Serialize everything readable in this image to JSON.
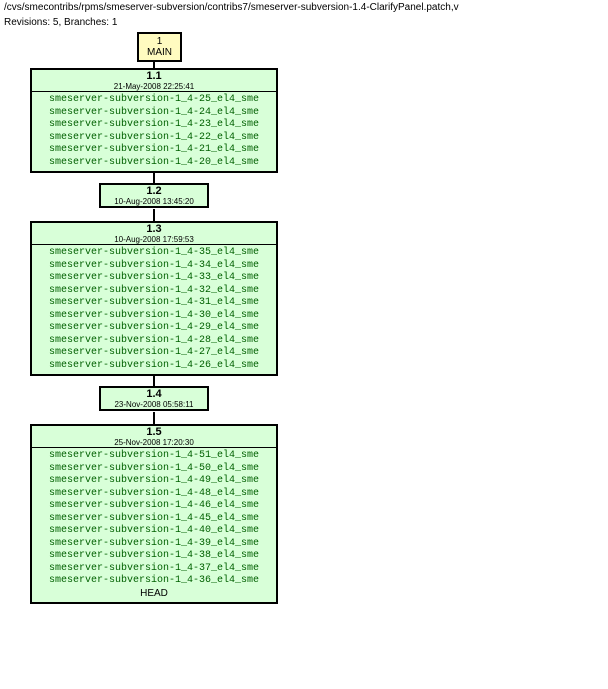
{
  "header": {
    "path": "/cvs/smecontribs/rpms/smeserver-subversion/contribs7/smeserver-subversion-1.4-ClarifyPanel.patch,v",
    "revinfo": "Revisions: 5, Branches: 1"
  },
  "branch": {
    "number": "1",
    "name": "MAIN"
  },
  "revisions": [
    {
      "version": "1.1",
      "date": "21-May-2008 22:25:41",
      "tags": [
        "smeserver-subversion-1_4-25_el4_sme",
        "smeserver-subversion-1_4-24_el4_sme",
        "smeserver-subversion-1_4-23_el4_sme",
        "smeserver-subversion-1_4-22_el4_sme",
        "smeserver-subversion-1_4-21_el4_sme",
        "smeserver-subversion-1_4-20_el4_sme"
      ]
    },
    {
      "version": "1.2",
      "date": "10-Aug-2008 13:45:20",
      "tags": []
    },
    {
      "version": "1.3",
      "date": "10-Aug-2008 17:59:53",
      "tags": [
        "smeserver-subversion-1_4-35_el4_sme",
        "smeserver-subversion-1_4-34_el4_sme",
        "smeserver-subversion-1_4-33_el4_sme",
        "smeserver-subversion-1_4-32_el4_sme",
        "smeserver-subversion-1_4-31_el4_sme",
        "smeserver-subversion-1_4-30_el4_sme",
        "smeserver-subversion-1_4-29_el4_sme",
        "smeserver-subversion-1_4-28_el4_sme",
        "smeserver-subversion-1_4-27_el4_sme",
        "smeserver-subversion-1_4-26_el4_sme"
      ]
    },
    {
      "version": "1.4",
      "date": "23-Nov-2008 05:58:11",
      "tags": []
    },
    {
      "version": "1.5",
      "date": "25-Nov-2008 17:20:30",
      "tags": [
        "smeserver-subversion-1_4-51_el4_sme",
        "smeserver-subversion-1_4-50_el4_sme",
        "smeserver-subversion-1_4-49_el4_sme",
        "smeserver-subversion-1_4-48_el4_sme",
        "smeserver-subversion-1_4-46_el4_sme",
        "smeserver-subversion-1_4-45_el4_sme",
        "smeserver-subversion-1_4-40_el4_sme",
        "smeserver-subversion-1_4-39_el4_sme",
        "smeserver-subversion-1_4-38_el4_sme",
        "smeserver-subversion-1_4-37_el4_sme",
        "smeserver-subversion-1_4-36_el4_sme"
      ],
      "headTag": "HEAD"
    }
  ]
}
